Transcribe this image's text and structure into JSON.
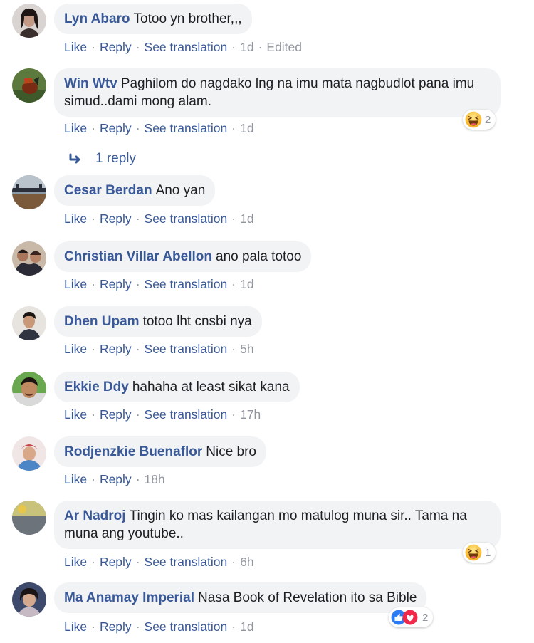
{
  "actions": {
    "like": "Like",
    "reply": "Reply",
    "see_translation": "See translation",
    "sep": "·"
  },
  "comments": [
    {
      "author": "Lyn Abaro",
      "text": "Totoo yn brother,,,",
      "time": "1d",
      "edited": "Edited"
    },
    {
      "author": "Win Wtv",
      "text": "Paghilom do nagdako lng na imu mata nagbudlot pana imu simud..dami mong alam.",
      "time": "1d",
      "reaction_icon": "haha-icon",
      "reaction_count": "2",
      "replies_label": "1 reply"
    },
    {
      "author": "Cesar Berdan",
      "text": "Ano yan",
      "time": "1d"
    },
    {
      "author": "Christian Villar Abellon",
      "text": "ano pala totoo",
      "time": "1d"
    },
    {
      "author": "Dhen Upam",
      "text": "totoo lht cnsbi nya",
      "time": "5h"
    },
    {
      "author": "Ekkie Ddy",
      "text": "hahaha at least sikat kana",
      "time": "17h"
    },
    {
      "author": "Rodjenzkie Buenaflor",
      "text": "Nice bro",
      "time": "18h"
    },
    {
      "author": "Ar Nadroj",
      "text": "Tingin ko mas kailangan mo matulog muna sir.. Tama na muna ang youtube..",
      "time": "6h",
      "reaction_icon": "haha-icon",
      "reaction_count": "1"
    },
    {
      "author": "Ma Anamay Imperial",
      "text": "Nasa Book of Revelation ito sa Bible",
      "time": "1d",
      "reaction_icon": "like-love-icons",
      "reaction_count": "2"
    }
  ],
  "colors": {
    "link": "#385898",
    "meta": "#90949c",
    "bubble": "#f2f3f5",
    "text": "#1c1e21"
  }
}
